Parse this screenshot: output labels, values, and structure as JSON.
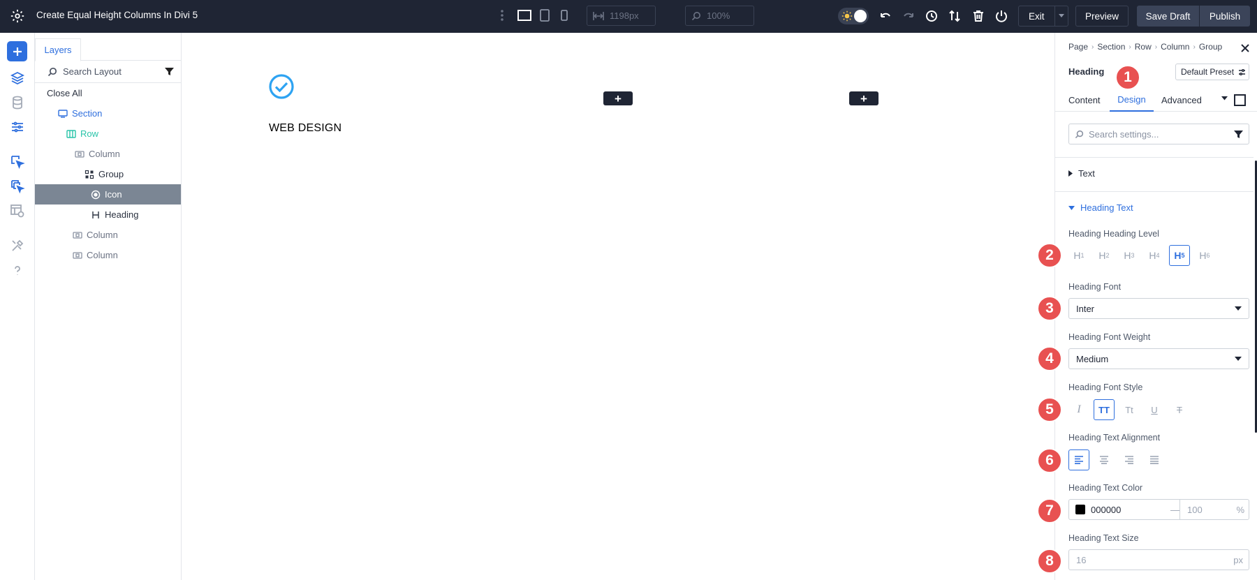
{
  "topbar": {
    "title": "Create Equal Height Columns In Divi 5",
    "width_value": "1198px",
    "zoom_value": "100%",
    "exit_label": "Exit",
    "preview_label": "Preview",
    "save_label": "Save Draft",
    "publish_label": "Publish"
  },
  "layers": {
    "tab_label": "Layers",
    "search_placeholder": "Search Layout",
    "items": [
      {
        "label": "Close All"
      },
      {
        "label": "Section"
      },
      {
        "label": "Row"
      },
      {
        "label": "Column"
      },
      {
        "label": "Group"
      },
      {
        "label": "Icon"
      },
      {
        "label": "Heading"
      },
      {
        "label": "Column"
      },
      {
        "label": "Column"
      }
    ]
  },
  "canvas": {
    "heading_text": "WEB DESIGN",
    "add_label": "+"
  },
  "settings": {
    "breadcrumb": [
      "Page",
      "Section",
      "Row",
      "Column",
      "Group"
    ],
    "module_name": "Heading",
    "preset_label": "Default Preset",
    "tabs": [
      "Content",
      "Design",
      "Advanced"
    ],
    "search_placeholder": "Search settings...",
    "group_text": "Text",
    "group_heading_text": "Heading Text",
    "level_label": "Heading Heading Level",
    "levels": [
      "1",
      "2",
      "3",
      "4",
      "5",
      "6"
    ],
    "levels_prefix": "H",
    "font_label": "Heading Font",
    "font_value": "Inter",
    "weight_label": "Heading Font Weight",
    "weight_value": "Medium",
    "style_label": "Heading Font Style",
    "style_options": [
      "I",
      "TT",
      "Tt",
      "U",
      "T"
    ],
    "align_label": "Heading Text Alignment",
    "color_label": "Heading Text Color",
    "color_hex": "000000",
    "color_dash": "—",
    "color_opacity": "100",
    "color_pct": "%",
    "size_label": "Heading Text Size",
    "size_value": "16",
    "size_unit": "px"
  },
  "badges": [
    "1",
    "2",
    "3",
    "4",
    "5",
    "6",
    "7",
    "8"
  ],
  "colors": {
    "topbar_bg": "#1f2534",
    "accent_blue": "#2e6fde",
    "section_color": "#2e6fde",
    "row_color": "#29c4a9",
    "icon_color": "#2ea3f2",
    "badge_red": "#e85151",
    "selected_row_bg": "#7b8694",
    "swatch": "#000000"
  },
  "icons": {
    "topbar": [
      "gear-icon",
      "kebab-icon",
      "desktop-icon",
      "tablet-icon",
      "phone-icon",
      "width-icon",
      "zoom-icon",
      "sun-icon",
      "undo-icon",
      "redo-icon",
      "history-icon",
      "sort-icon",
      "trash-icon",
      "power-icon"
    ],
    "rail": [
      "plus-icon",
      "layers-icon",
      "database-icon",
      "settings-sliders-icon",
      "cursor-select-icon",
      "cursor-multi-icon",
      "layout-view-icon",
      "tools-icon",
      "help-icon"
    ]
  }
}
